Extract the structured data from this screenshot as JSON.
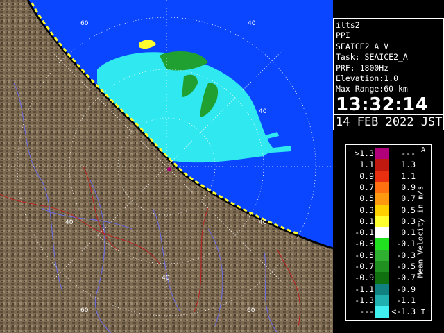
{
  "info": {
    "station": "ilts2",
    "product": "PPI",
    "volume": "SEAICE2_A_V",
    "task": "Task: SEAICE2_A",
    "prf": "PRF: 1800Hz",
    "elevation": "Elevation:1.0",
    "max_range": "Max Range:60 km",
    "time": "13:32:14",
    "date": "14 FEB 2022 JST"
  },
  "legend": {
    "title": "Mean Velocity in m/s",
    "corner_top": "A",
    "corner_bottom": "T",
    "rows": [
      {
        "lo": ">1.3",
        "hi": "---",
        "color": "#b0007a"
      },
      {
        "lo": "1.1",
        "hi": "1.3",
        "color": "#c01a10"
      },
      {
        "lo": "0.9",
        "hi": "1.1",
        "color": "#e83010"
      },
      {
        "lo": "0.7",
        "hi": "0.9",
        "color": "#ff7010"
      },
      {
        "lo": "0.5",
        "hi": "0.7",
        "color": "#ff9a10"
      },
      {
        "lo": "0.3",
        "hi": "0.5",
        "color": "#ffd000"
      },
      {
        "lo": "0.1",
        "hi": "0.3",
        "color": "#ffff30"
      },
      {
        "lo": "-0.1",
        "hi": "0.1",
        "color": "#ffffff"
      },
      {
        "lo": "-0.3",
        "hi": "-0.1",
        "color": "#20e020"
      },
      {
        "lo": "-0.5",
        "hi": "-0.3",
        "color": "#30b030"
      },
      {
        "lo": "-0.7",
        "hi": "-0.5",
        "color": "#209020"
      },
      {
        "lo": "-0.9",
        "hi": "-0.7",
        "color": "#107010"
      },
      {
        "lo": "-1.1",
        "hi": "-0.9",
        "color": "#108080"
      },
      {
        "lo": "-1.3",
        "hi": "-1.1",
        "color": "#20b0b0"
      },
      {
        "lo": "---",
        "hi": "<-1.3",
        "color": "#40f0f0"
      }
    ]
  },
  "map": {
    "range_labels": [
      "60",
      "40",
      "40",
      "40",
      "40",
      "60",
      "60",
      "40"
    ],
    "colors": {
      "sea": "#0a46ff",
      "land": "#7a6850",
      "echo": "#30e8f0",
      "rings": "#ffffff"
    }
  }
}
